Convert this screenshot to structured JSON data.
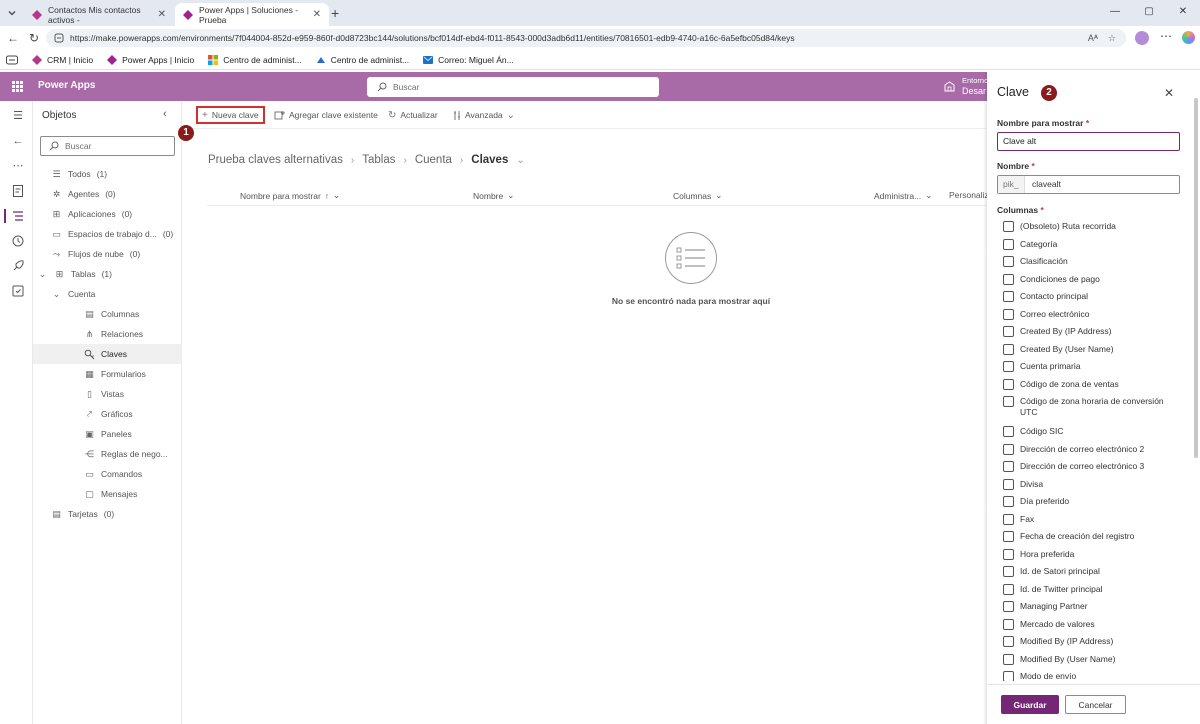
{
  "browser": {
    "tabs": [
      {
        "title": "Contactos Mis contactos activos -",
        "active": false
      },
      {
        "title": "Power Apps | Soluciones - Prueba",
        "active": true
      }
    ],
    "url": "https://make.powerapps.com/environments/7f044004-852d-e959-860f-d0d8723bc144/solutions/bcf014df-ebd4-f011-8543-000d3adb6d11/entities/70816501-edb9-4740-a16c-6a5efbc05d84/keys",
    "bookmarks": [
      "CRM | Inicio",
      "Power Apps | Inicio",
      "Centro de administ...",
      "Centro de administ...",
      "Correo: Miguel Án..."
    ]
  },
  "header": {
    "app_title": "Power Apps",
    "search_placeholder": "Buscar",
    "env_line1": "Entorno",
    "env_line2": "Desar"
  },
  "objects": {
    "title": "Objetos",
    "search_placeholder": "Buscar",
    "items": [
      {
        "label": "Todos",
        "count": "(1)"
      },
      {
        "label": "Agentes",
        "count": "(0)"
      },
      {
        "label": "Aplicaciones",
        "count": "(0)"
      },
      {
        "label": "Espacios de trabajo d...",
        "count": "(0)"
      },
      {
        "label": "Flujos de nube",
        "count": "(0)"
      },
      {
        "label": "Tablas",
        "count": "(1)"
      },
      {
        "label": "Cuenta",
        "count": ""
      },
      {
        "label": "Columnas",
        "count": ""
      },
      {
        "label": "Relaciones",
        "count": ""
      },
      {
        "label": "Claves",
        "count": ""
      },
      {
        "label": "Formularios",
        "count": ""
      },
      {
        "label": "Vistas",
        "count": ""
      },
      {
        "label": "Gráficos",
        "count": ""
      },
      {
        "label": "Paneles",
        "count": ""
      },
      {
        "label": "Reglas de nego...",
        "count": ""
      },
      {
        "label": "Comandos",
        "count": ""
      },
      {
        "label": "Mensajes",
        "count": ""
      },
      {
        "label": "Tarjetas",
        "count": "(0)"
      }
    ]
  },
  "commands": {
    "new_key": "Nueva clave",
    "add_existing": "Agregar clave existente",
    "refresh": "Actualizar",
    "advanced": "Avanzada"
  },
  "markers": {
    "one": "1",
    "two": "2"
  },
  "breadcrumb": [
    "Prueba claves alternativas",
    "Tablas",
    "Cuenta",
    "Claves"
  ],
  "grid": {
    "columns": [
      "Nombre para mostrar",
      "Nombre",
      "Columnas",
      "Administra...",
      "Personaliz"
    ],
    "empty_message": "No se encontró nada para mostrar aquí"
  },
  "panel": {
    "title": "Clave",
    "display_name_label": "Nombre para mostrar",
    "display_name_value": "Clave alt",
    "name_label": "Nombre",
    "name_prefix": "pik_",
    "name_value": "clavealt",
    "columns_label": "Columnas",
    "required_mark": "*",
    "columns": [
      "(Obsoleto) Ruta recorrida",
      "Categoría",
      "Clasificación",
      "Condiciones de pago",
      "Contacto principal",
      "Correo electrónico",
      "Created By (IP Address)",
      "Created By (User Name)",
      "Cuenta primaria",
      "Código de zona de ventas",
      "Código de zona horaria de conversión UTC",
      "Código SIC",
      "Dirección de correo electrónico 2",
      "Dirección de correo electrónico 3",
      "Divisa",
      "Día preferido",
      "Fax",
      "Fecha de creación del registro",
      "Hora preferida",
      "Id. de Satori principal",
      "Id. de Twitter principal",
      "Managing Partner",
      "Mercado de valores",
      "Modified By (IP Address)",
      "Modified By (User Name)",
      "Modo de envío"
    ],
    "save_label": "Guardar",
    "cancel_label": "Cancelar"
  },
  "colors": {
    "brand": "#742774",
    "header": "#a86ba8",
    "highlight": "#d32f2f",
    "marker": "#8b1a1a"
  }
}
